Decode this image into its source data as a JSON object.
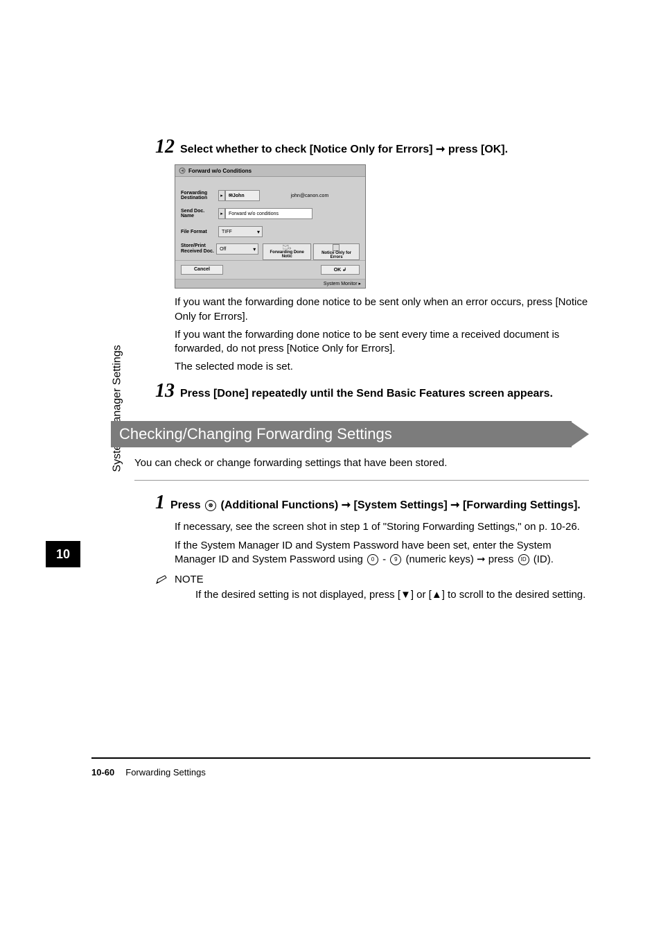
{
  "sidebar": {
    "rotated_label": "System Manager Settings",
    "chapter_number": "10"
  },
  "step12": {
    "number": "12",
    "text_prefix": "Select whether to check [Notice Only for Errors] ",
    "text_suffix": " press [OK].",
    "arrow": "➞"
  },
  "screenshot": {
    "title": "Forward w/o Conditions",
    "rows": {
      "forwarding_destination_label": "Forwarding Destination",
      "forwarding_destination_value": "John",
      "forwarding_destination_email": "john@canon.com",
      "send_doc_label": "Send Doc. Name",
      "send_doc_value": "Forward w/o conditions",
      "file_format_label": "File Format",
      "file_format_value": "TIFF",
      "store_print_label": "Store/Print Received Doc.",
      "store_print_value": "Off",
      "forwarding_done_btn": "Forwarding Done Notic",
      "notice_only_btn": "Notice Only for Errors"
    },
    "cancel": "Cancel",
    "ok": "OK",
    "system_monitor": "System Monitor ▸"
  },
  "paragraphs": {
    "p1": "If you want the forwarding done notice to be sent only when an error occurs, press [Notice Only for Errors].",
    "p2": "If you want the forwarding done notice to be sent every time a received document is forwarded, do not press [Notice Only for Errors].",
    "p3": "The selected mode is set."
  },
  "step13": {
    "number": "13",
    "text": "Press [Done] repeatedly until the Send Basic Features screen appears."
  },
  "section_heading": "Checking/Changing Forwarding Settings",
  "section_intro": "You can check or change forwarding settings that have been stored.",
  "step1": {
    "number": "1",
    "text_part1": "Press ",
    "text_part2": " (Additional Functions) ",
    "text_part3": " [System Settings] ",
    "text_part4": " [Forwarding Settings].",
    "arrow": "➞"
  },
  "step1_paragraphs": {
    "p1": "If necessary, see the screen shot in step 1 of \"Storing Forwarding Settings,\" on p. 10-26.",
    "p2_a": "If the System Manager ID and System Password have been set, enter the System Manager ID and System Password using ",
    "p2_b": " - ",
    "p2_c": " (numeric keys) ",
    "p2_d": " press ",
    "p2_e": " (ID)."
  },
  "note": {
    "label": "NOTE",
    "text": "If the desired setting is not displayed, press [▼] or [▲] to scroll to the desired setting."
  },
  "footer": {
    "page_number": "10-60",
    "section": "Forwarding Settings"
  }
}
